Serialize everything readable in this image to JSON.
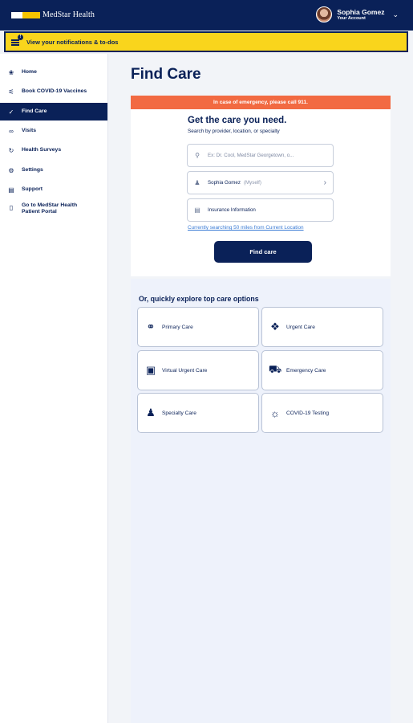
{
  "header": {
    "logo_text": "MedStar Health",
    "account_name": "Sophia Gomez",
    "account_sub": "Your Account",
    "chevron": "chevron-down-icon"
  },
  "notification": {
    "text": "View your notifications & to-dos",
    "badge": "!"
  },
  "sidebar": {
    "items": [
      {
        "label": "Home",
        "icon": "home-icon"
      },
      {
        "label": "Book COVID-19 Vaccines",
        "icon": "vaccine-icon"
      },
      {
        "label": "Find Care",
        "icon": "stethoscope-icon",
        "active": true
      },
      {
        "label": "Visits",
        "icon": "link-icon"
      },
      {
        "label": "Health Surveys",
        "icon": "survey-icon"
      },
      {
        "label": "Settings",
        "icon": "gear-icon"
      },
      {
        "label": "Support",
        "icon": "support-icon"
      },
      {
        "label": "Go to MedStar Health Patient Portal",
        "icon": "portal-icon"
      }
    ]
  },
  "main": {
    "title": "Find Care",
    "emergency": "In case of emergency, please call 911.",
    "heading": "Get the care you need.",
    "subheading": "Search by provider, location, or specialty",
    "search_placeholder": "Ex: Dr. Cool, MedStar Georgetown, o...",
    "patient_name": "Sophia Gomez",
    "patient_relation": "(Myself)",
    "insurance_label": "Insurance Information",
    "location_link": "Currently searching 50 miles from Current Location",
    "find_button": "Find care"
  },
  "explore": {
    "title": "Or, quickly explore top care options",
    "options": [
      {
        "label": "Primary Care",
        "icon": "stethoscope-icon"
      },
      {
        "label": "Urgent Care",
        "icon": "bandage-icon"
      },
      {
        "label": "Virtual Urgent Care",
        "icon": "laptop-icon"
      },
      {
        "label": "Emergency Care",
        "icon": "ambulance-icon"
      },
      {
        "label": "Specialty Care",
        "icon": "specialist-icon"
      },
      {
        "label": "COVID-19 Testing",
        "icon": "virus-icon"
      }
    ]
  },
  "colors": {
    "navy": "#0a2158",
    "yellow": "#f9d51c",
    "emergency": "#f26a42",
    "link": "#3a7bd5"
  }
}
